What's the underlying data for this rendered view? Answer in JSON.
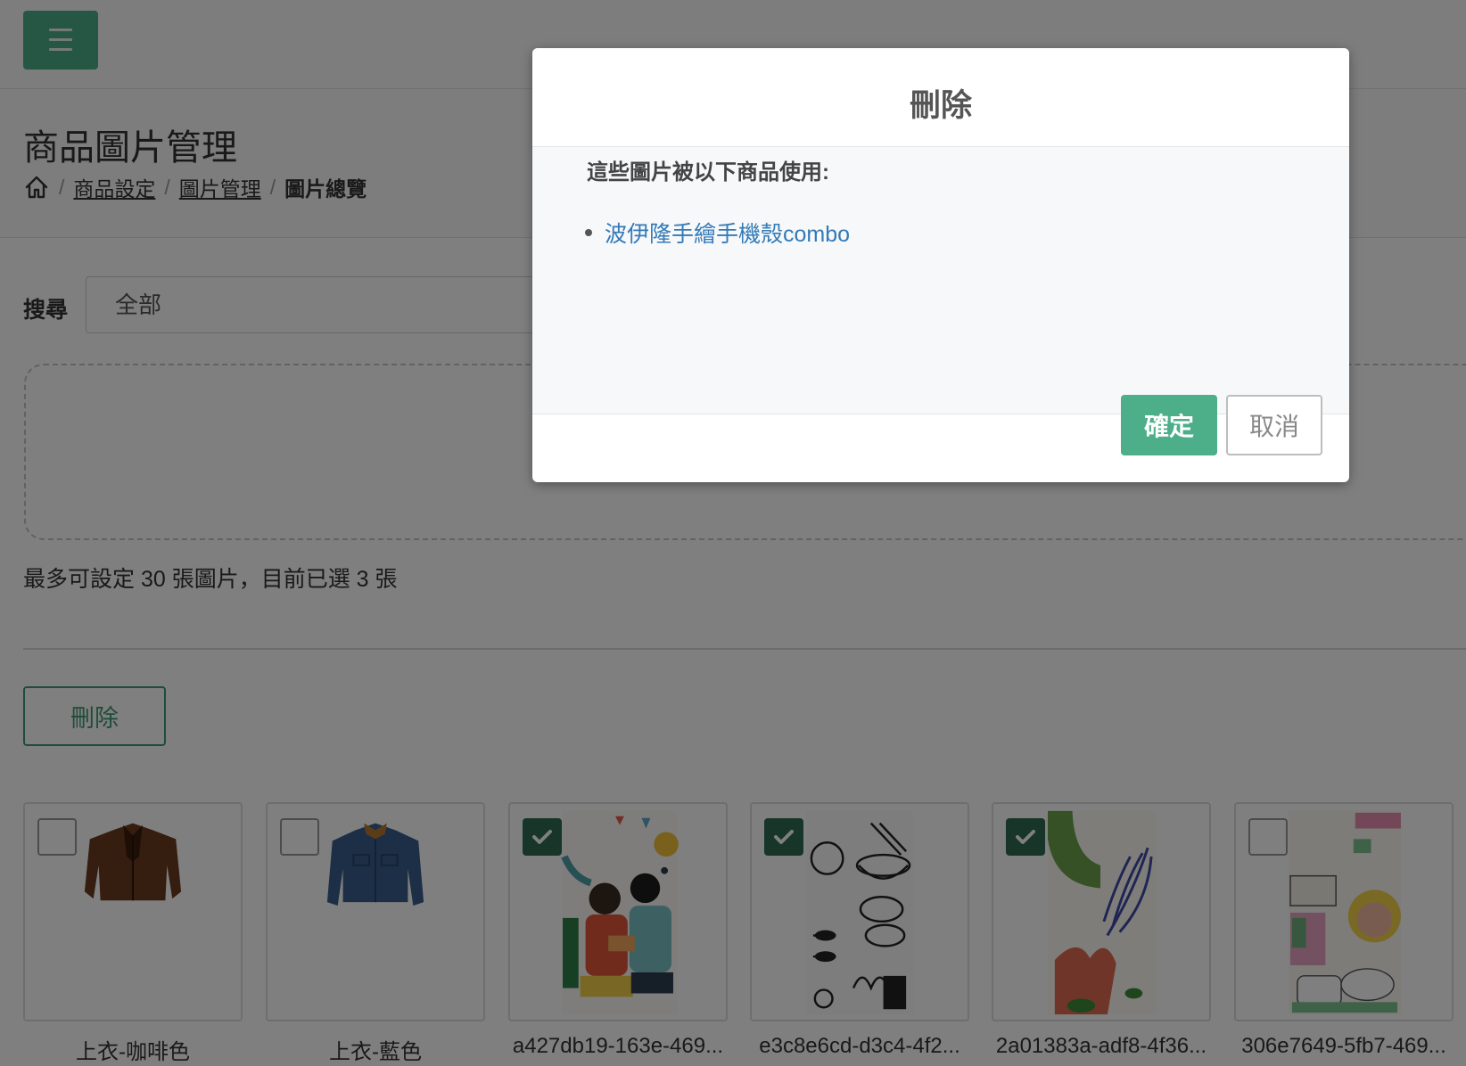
{
  "header": {
    "title": "商品圖片管理",
    "breadcrumb": [
      "商品設定",
      "圖片管理",
      "圖片總覽"
    ],
    "separator": "/"
  },
  "search": {
    "label": "搜尋",
    "value": "全部"
  },
  "limit_text": "最多可設定 30 張圖片，目前已選 3 張",
  "delete_label": "刪除",
  "images": [
    {
      "label": "上衣-咖啡色",
      "checked": false
    },
    {
      "label": "上衣-藍色",
      "checked": false
    },
    {
      "label": "a427db19-163e-469...",
      "checked": true
    },
    {
      "label": "e3c8e6cd-d3c4-4f2...",
      "checked": true
    },
    {
      "label": "2a01383a-adf8-4f36...",
      "checked": true
    },
    {
      "label": "306e7649-5fb7-469...",
      "checked": false
    }
  ],
  "modal": {
    "title": "刪除",
    "message": "這些圖片被以下商品使用:",
    "products": [
      "波伊隆手繪手機殼combo"
    ],
    "confirm_label": "確定",
    "cancel_label": "取消"
  },
  "colors": {
    "accent": "#4caf8a",
    "accent_dark": "#2e6a52",
    "link": "#337ab7",
    "overlay": "rgba(0,0,0,0.5)"
  }
}
